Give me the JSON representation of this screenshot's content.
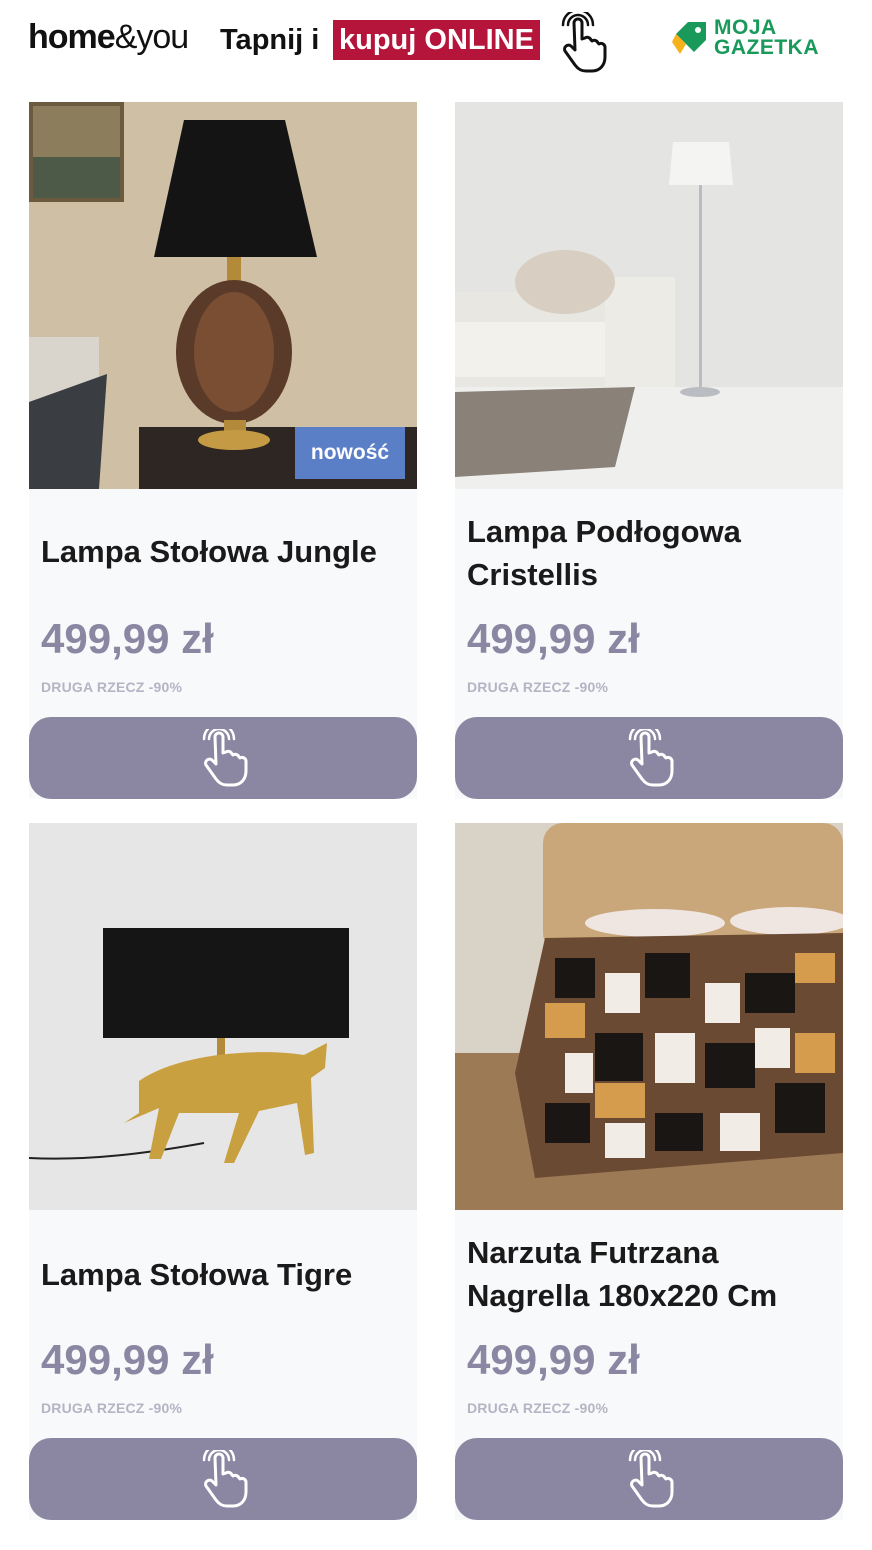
{
  "header": {
    "brand_bold": "home",
    "brand_light": "&you",
    "tap_text": "Tapnij i",
    "cta_highlight": "kupuj ONLINE",
    "partner_line1": "MOJA",
    "partner_line2": "GAZETKA",
    "highlight_color": "#b5153a",
    "partner_color": "#1a9a5a"
  },
  "products": [
    {
      "title": "Lampa Stołowa Jungle",
      "price": "499,99 zł",
      "promo": "DRUGA RZECZ -90%",
      "badge": "nowość",
      "image_icon": "table-lamp-image"
    },
    {
      "title": "Lampa Podłogowa Cristellis",
      "price": "499,99 zł",
      "promo": "DRUGA RZECZ -90%",
      "image_icon": "floor-lamp-image"
    },
    {
      "title": "Lampa Stołowa Tigre",
      "price": "499,99 zł",
      "promo": "DRUGA RZECZ -90%",
      "image_icon": "tiger-lamp-image"
    },
    {
      "title": "Narzuta Futrzana Nagrella 180x220 Cm",
      "price": "499,99 zł",
      "promo": "DRUGA RZECZ -90%",
      "image_icon": "fur-blanket-image"
    }
  ],
  "colors": {
    "button": "#8b87a2",
    "price": "#8b87a2",
    "badge": "#5b7fc7"
  }
}
